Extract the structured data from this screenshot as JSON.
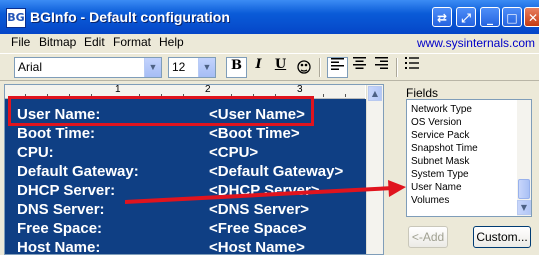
{
  "window": {
    "title": "BGInfo - Default configuration",
    "app_icon_glyph": "BG"
  },
  "menubar": {
    "items": [
      "File",
      "Bitmap",
      "Edit",
      "Format",
      "Help"
    ],
    "site_link": "www.sysinternals.com"
  },
  "toolbar": {
    "font_name": "Arial",
    "font_size": "12",
    "bold": "B",
    "italic": "I",
    "underline": "U",
    "align": "left"
  },
  "ruler": {
    "numbers": [
      "1",
      "2",
      "3"
    ]
  },
  "editor": {
    "rows": [
      {
        "label": "User Name:",
        "value": "<User Name>"
      },
      {
        "label": "Boot Time:",
        "value": "<Boot Time>"
      },
      {
        "label": "CPU:",
        "value": "<CPU>"
      },
      {
        "label": "Default Gateway:",
        "value": "<Default Gateway>"
      },
      {
        "label": "DHCP Server:",
        "value": "<DHCP Server>"
      },
      {
        "label": "DNS Server:",
        "value": "<DNS Server>"
      },
      {
        "label": "Free Space:",
        "value": "<Free Space>"
      },
      {
        "label": "Host Name:",
        "value": "<Host Name>"
      }
    ],
    "background_color": "#0F3F84",
    "text_color": "#FFFFFF"
  },
  "fields": {
    "label": "Fields",
    "items": [
      "Network Type",
      "OS Version",
      "Service Pack",
      "Snapshot Time",
      "Subnet Mask",
      "System Type",
      "User Name",
      "Volumes"
    ]
  },
  "buttons": {
    "add": "<-Add",
    "custom": "Custom..."
  },
  "annotation": {
    "color": "#E0141E"
  }
}
